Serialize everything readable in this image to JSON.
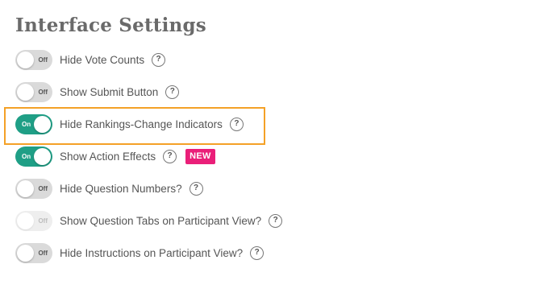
{
  "section": {
    "title": "Interface Settings"
  },
  "help_glyph": "?",
  "badge_new": "NEW",
  "colors": {
    "toggle_on": "#1f9f86",
    "toggle_off": "#dadada",
    "highlight": "#f4a127",
    "badge": "#ea1f79"
  },
  "settings": [
    {
      "label": "Hide Vote Counts",
      "state": "Off",
      "on": false,
      "disabled": false
    },
    {
      "label": "Show Submit Button",
      "state": "Off",
      "on": false,
      "disabled": false
    },
    {
      "label": "Hide Rankings-Change Indicators",
      "state": "On",
      "on": true,
      "disabled": false,
      "highlighted": true
    },
    {
      "label": "Show Action Effects",
      "state": "On",
      "on": true,
      "disabled": false,
      "badge": "NEW"
    },
    {
      "label": "Hide Question Numbers?",
      "state": "Off",
      "on": false,
      "disabled": false
    },
    {
      "label": "Show Question Tabs on Participant View?",
      "state": "Off",
      "on": false,
      "disabled": true
    },
    {
      "label": "Hide Instructions on Participant View?",
      "state": "Off",
      "on": false,
      "disabled": false
    }
  ]
}
